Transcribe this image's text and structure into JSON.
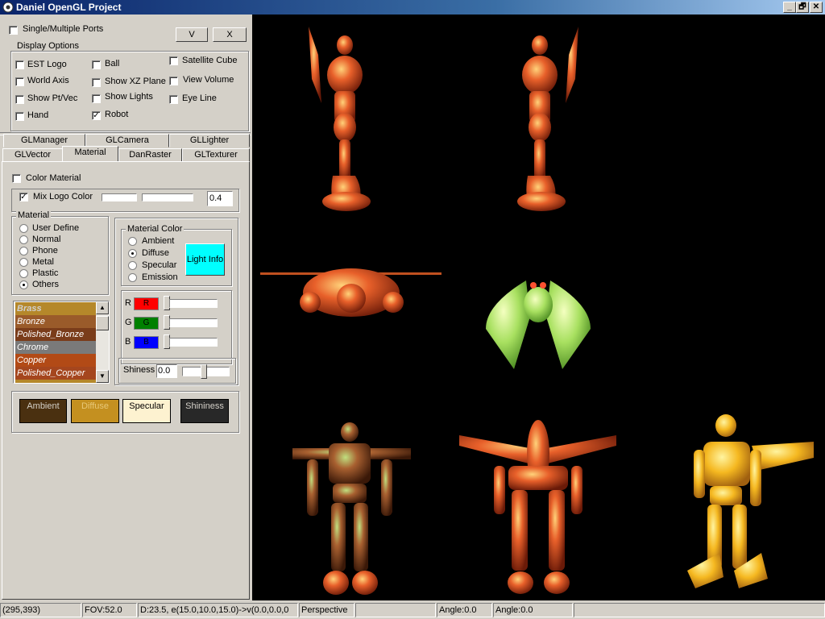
{
  "window": {
    "title": "Daniel OpenGL Project",
    "controls": [
      "_",
      "🗗",
      "✕"
    ]
  },
  "ports": {
    "single_multiple_label": "Single/Multiple Ports",
    "v_button": "V",
    "x_button": "X"
  },
  "display_options": {
    "legend": "Display Options",
    "items": [
      {
        "label": "EST Logo",
        "checked": false
      },
      {
        "label": "World Axis",
        "checked": false
      },
      {
        "label": "Show Pt/Vec",
        "checked": false
      },
      {
        "label": "Hand",
        "checked": false
      },
      {
        "label": "Ball",
        "checked": false
      },
      {
        "label": "Show XZ Plane",
        "checked": false
      },
      {
        "label": "Show Lights",
        "checked": false
      },
      {
        "label": "Robot",
        "checked": true
      },
      {
        "label": "Satellite Cube",
        "checked": false
      },
      {
        "label": "View Volume",
        "checked": false
      },
      {
        "label": "Eye Line",
        "checked": false
      }
    ]
  },
  "tabs": {
    "row1": [
      "GLManager",
      "GLCamera",
      "GLLighter"
    ],
    "row2": [
      "GLVector",
      "Material",
      "DanRaster",
      "GLTexturer"
    ],
    "active": "Material"
  },
  "material_tab": {
    "color_material_label": "Color Material",
    "color_material_checked": false,
    "mix_logo_label": "Mix Logo Color",
    "mix_logo_checked": true,
    "mix_value": "0.4",
    "material_legend": "Material",
    "material_options": [
      "User Define",
      "Normal",
      "Phone",
      "Metal",
      "Plastic",
      "Others"
    ],
    "material_selected": "Others",
    "material_color_legend": "Material Color",
    "color_options": [
      "Ambient",
      "Diffuse",
      "Specular",
      "Emission"
    ],
    "color_selected": "Diffuse",
    "light_info_button": "Light Info",
    "rgb": [
      {
        "label": "R",
        "text": "R",
        "color": "#ff0000"
      },
      {
        "label": "G",
        "text": "G",
        "color": "#008000"
      },
      {
        "label": "B",
        "text": "B",
        "color": "#0000ff"
      }
    ],
    "shiness_label": "Shiness",
    "shiness_value": "0.0",
    "material_list": [
      {
        "name": "Brass",
        "color": "#b5882a"
      },
      {
        "name": "Bronze",
        "color": "#9a5b2a"
      },
      {
        "name": "Polished_Bronze",
        "color": "#7a3c1a"
      },
      {
        "name": "Chrome",
        "color": "#7a7a7a"
      },
      {
        "name": "Copper",
        "color": "#b24a16"
      },
      {
        "name": "Polished_Copper",
        "color": "#a5461e"
      }
    ],
    "swatches": [
      {
        "label": "Ambient",
        "color": "#4a3010",
        "text": "#d4d0c8"
      },
      {
        "label": "Diffuse",
        "color": "#c49020",
        "text": "#e0c070"
      },
      {
        "label": "Specular",
        "color": "#fdf2d0",
        "text": "#000000"
      },
      {
        "label": "Shininess",
        "color": "#282828",
        "text": "#d4d0c8"
      }
    ]
  },
  "status": {
    "coords": "(295,393)",
    "fov": "FOV:52.0",
    "camera": "D:23.5, e(15.0,10.0,15.0)->v(0.0,0.0,0",
    "projection": "Perspective",
    "angle1": "Angle:0.0",
    "angle2": "Angle:0.0"
  }
}
